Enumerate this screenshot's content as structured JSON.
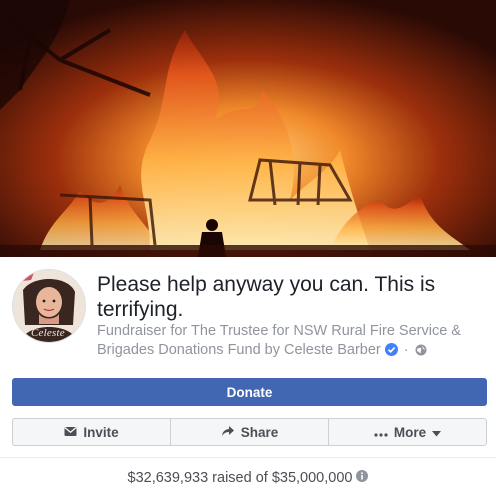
{
  "post": {
    "title": "Please help anyway you can. This is terrifying.",
    "fundraiser_prefix": "Fundraiser for ",
    "beneficiary": "The Trustee for NSW Rural Fire Service & Brigades Donations Fund",
    "by_prefix": " by ",
    "organizer": "Celeste Barber",
    "separator": "·",
    "avatar_caption": "Celeste"
  },
  "actions": {
    "donate_label": "Donate",
    "invite_label": "Invite",
    "share_label": "Share",
    "more_label": "More"
  },
  "progress": {
    "text": "$32,639,933 raised of $35,000,000",
    "raised": 32639933,
    "goal": 35000000
  },
  "icons": {
    "invite": "envelope-icon",
    "share": "share-arrow-icon",
    "more": "dots-icon",
    "verified": "verified-badge-icon",
    "privacy": "globe-icon",
    "info": "info-icon"
  },
  "colors": {
    "primary": "#4267b2",
    "text": "#1d2129",
    "muted": "#90949c",
    "verified": "#4080ff"
  }
}
